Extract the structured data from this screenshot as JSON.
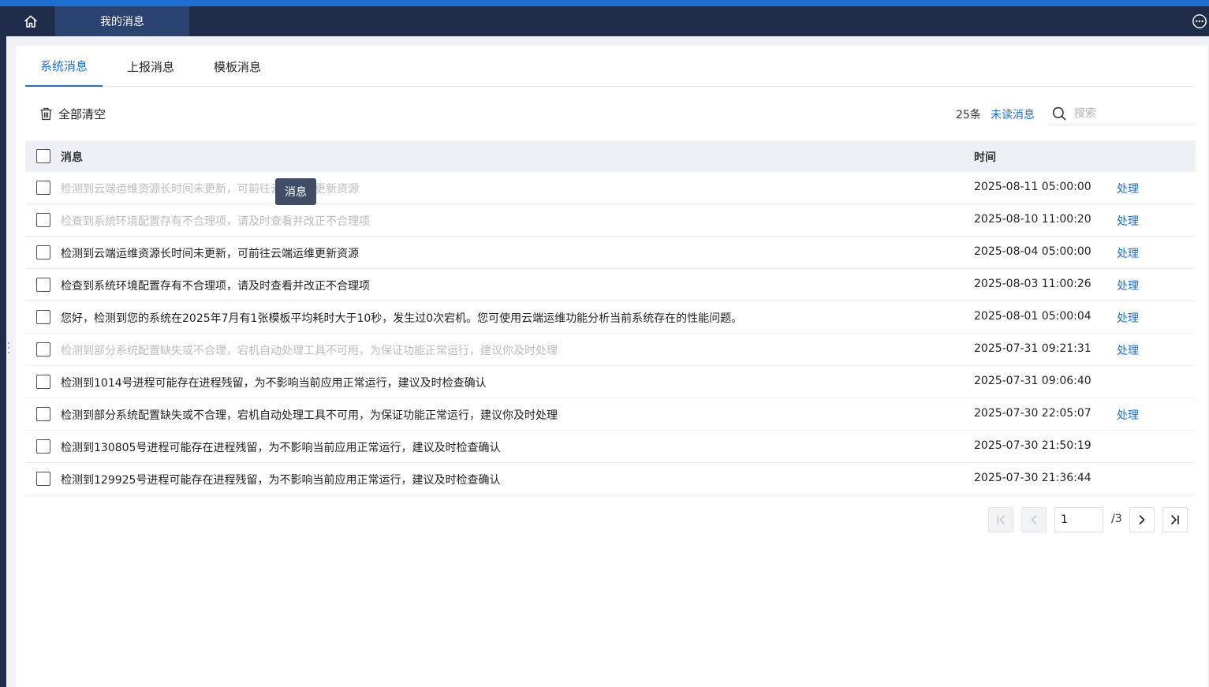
{
  "topbar": {
    "home_icon": "home-icon",
    "active_tab_label": "我的消息",
    "more_icon": "more-horizontal-icon"
  },
  "tabs": [
    {
      "label": "系统消息",
      "active": true
    },
    {
      "label": "上报消息",
      "active": false
    },
    {
      "label": "模板消息",
      "active": false
    }
  ],
  "toolbar": {
    "clear_label": "全部清空",
    "clear_icon": "trash-icon",
    "count_label": "25条",
    "unread_label": "未读消息",
    "search_icon": "search-icon",
    "search_placeholder": "搜索",
    "search_value": ""
  },
  "table": {
    "header": {
      "message": "消息",
      "time": "时间"
    },
    "rows": [
      {
        "message": "检测到云端运维资源长时间未更新，可前往云端运维更新资源",
        "time": "2025-08-11 05:00:00",
        "action": "处理",
        "read": true
      },
      {
        "message": "检查到系统环境配置存有不合理项，请及时查看并改正不合理项",
        "time": "2025-08-10 11:00:20",
        "action": "处理",
        "read": true
      },
      {
        "message": "检测到云端运维资源长时间未更新，可前往云端运维更新资源",
        "time": "2025-08-04 05:00:00",
        "action": "处理",
        "read": false
      },
      {
        "message": "检查到系统环境配置存有不合理项，请及时查看并改正不合理项",
        "time": "2025-08-03 11:00:26",
        "action": "处理",
        "read": false
      },
      {
        "message": "您好，检测到您的系统在2025年7月有1张模板平均耗时大于10秒，发生过0次宕机。您可使用云端运维功能分析当前系统存在的性能问题。",
        "time": "2025-08-01 05:00:04",
        "action": "处理",
        "read": false
      },
      {
        "message": "检测到部分系统配置缺失或不合理，宕机自动处理工具不可用，为保证功能正常运行，建议你及时处理",
        "time": "2025-07-31 09:21:31",
        "action": "处理",
        "read": true
      },
      {
        "message": "检测到1014号进程可能存在进程残留，为不影响当前应用正常运行，建议及时检查确认",
        "time": "2025-07-31 09:06:40",
        "action": "",
        "read": false
      },
      {
        "message": "检测到部分系统配置缺失或不合理，宕机自动处理工具不可用，为保证功能正常运行，建议你及时处理",
        "time": "2025-07-30 22:05:07",
        "action": "处理",
        "read": false
      },
      {
        "message": "检测到130805号进程可能存在进程残留，为不影响当前应用正常运行，建议及时检查确认",
        "time": "2025-07-30 21:50:19",
        "action": "",
        "read": false
      },
      {
        "message": "检测到129925号进程可能存在进程残留，为不影响当前应用正常运行，建议及时检查确认",
        "time": "2025-07-30 21:36:44",
        "action": "",
        "read": false
      }
    ]
  },
  "tooltip": {
    "text": "消息"
  },
  "pagination": {
    "current_page": "1",
    "total_label": "/3",
    "first_icon": "first-page-icon",
    "prev_icon": "chevron-left-icon",
    "next_icon": "chevron-right-icon",
    "last_icon": "last-page-icon"
  },
  "colors": {
    "accent": "#1d6fd1",
    "topbar_bg": "#1f2d4a",
    "active_tab_bg": "#2b4371",
    "read_text": "#b9bcc2",
    "header_bg": "#edf1f6"
  }
}
